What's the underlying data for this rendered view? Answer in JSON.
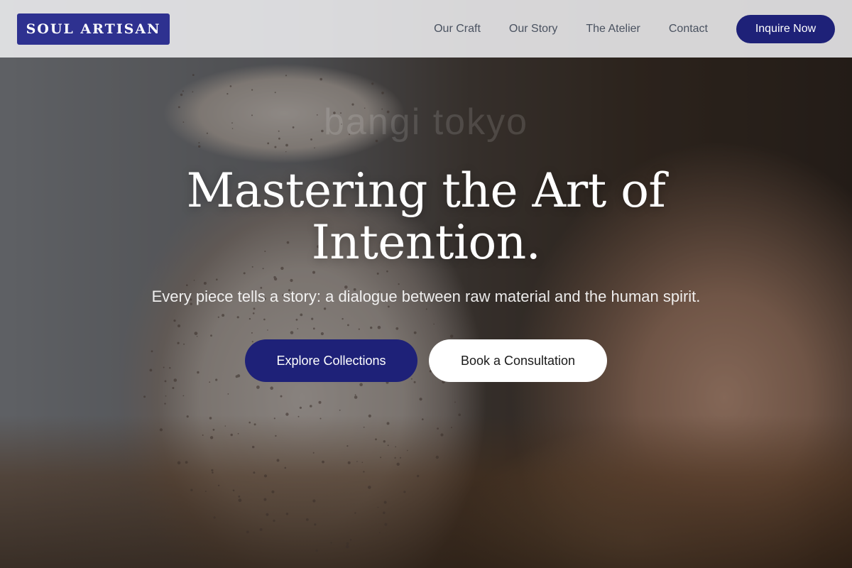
{
  "brand": {
    "name": "SOUL ARTISAN"
  },
  "nav": {
    "links": [
      "Our Craft",
      "Our Story",
      "The Atelier",
      "Contact"
    ],
    "cta_label": "Inquire Now"
  },
  "hero": {
    "headline_line1": "Mastering the Art of",
    "headline_line2": "Intention.",
    "subtext": "Every piece tells a story: a dialogue between raw material and the human spirit.",
    "primary_cta": "Explore Collections",
    "secondary_cta": "Book a Consultation",
    "image_watermark": "bangi tokyo"
  },
  "colors": {
    "accent": "#1e2178",
    "logo_bg": "#2e3190",
    "nav_bg": "#eeeef0",
    "nav_text": "#4a5260"
  }
}
